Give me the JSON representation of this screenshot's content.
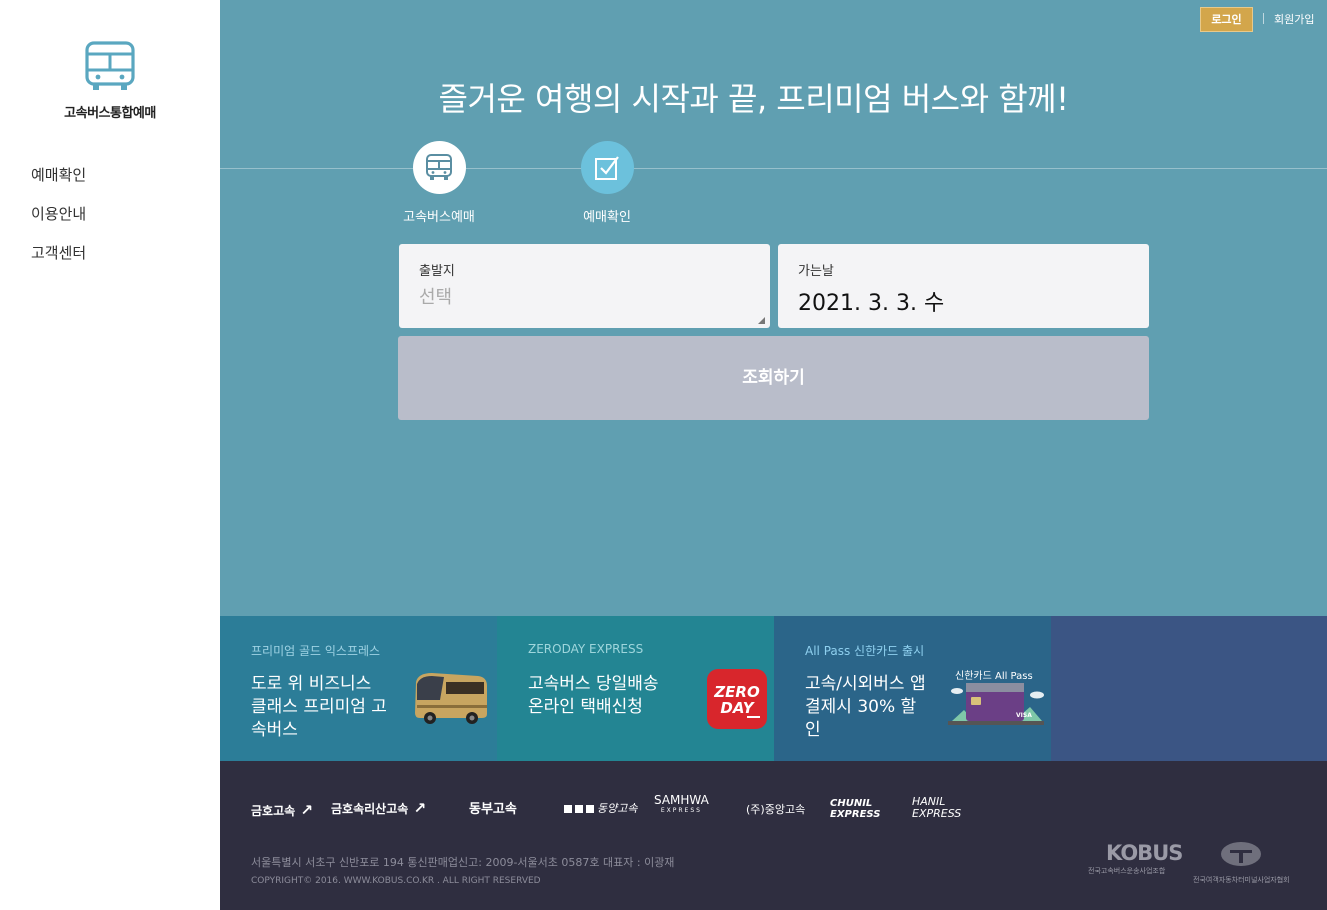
{
  "sidebar": {
    "brand": "고속버스통합예매",
    "nav": [
      "예매확인",
      "이용안내",
      "고객센터"
    ]
  },
  "header": {
    "login": "로그인",
    "join": "회원가입"
  },
  "hero": {
    "title": "즐거운 여행의 시작과 끝, 프리미엄 버스와 함께!",
    "tabs": [
      {
        "label": "고속버스예매",
        "icon": "bus-icon"
      },
      {
        "label": "예매확인",
        "icon": "checkbox-icon"
      }
    ],
    "departure": {
      "label": "출발지",
      "placeholder": "선택"
    },
    "date": {
      "label": "가는날",
      "value": "2021. 3. 3. 수"
    },
    "search_button": "조회하기"
  },
  "banners": [
    {
      "tag": "프리미엄 골드 익스프레스",
      "text": "도로 위 비즈니스 클래스 프리미엄 고속버스"
    },
    {
      "tag": "ZERODAY EXPRESS",
      "text": "고속버스 당일배송 온라인 택배신청",
      "logo_line1": "ZERO",
      "logo_line2": "DAY"
    },
    {
      "tag": "All Pass 신한카드 출시",
      "text": "고속/시외버스 앱 결제시 30% 할인",
      "card_caption": "신한카드 All Pass"
    }
  ],
  "footer": {
    "logos": [
      "금호고속",
      "금호속리산고속",
      "동부고속",
      "동양고속",
      "SAMHWA",
      "(주)중앙고속",
      "CHUNIL EXPRESS",
      "HANIL EXPRESS"
    ],
    "samhwa_sub": "EXPRESS",
    "address": "서울특별시 서초구 신반포로 194 통신판매업신고: 2009-서울서초 0587호 대표자 : 이광재",
    "copyright": "COPYRIGHT© 2016. WWW.KOBUS.CO.KR . ALL RIGHT RESERVED",
    "kobus": "KOBUS",
    "kobus_sub": "전국고속버스운송사업조합",
    "association": "전국여객자동차터미널사업자협회"
  },
  "colors": {
    "hero_bg": "#609fb1",
    "login_bg": "#d3a64b",
    "search_btn": "#b9bdca",
    "footer_bg": "#2f2e40",
    "banner_1": "#2c7d98",
    "banner_2": "#238593",
    "banner_3": "#2b6589",
    "banner_4": "#3b5584"
  }
}
